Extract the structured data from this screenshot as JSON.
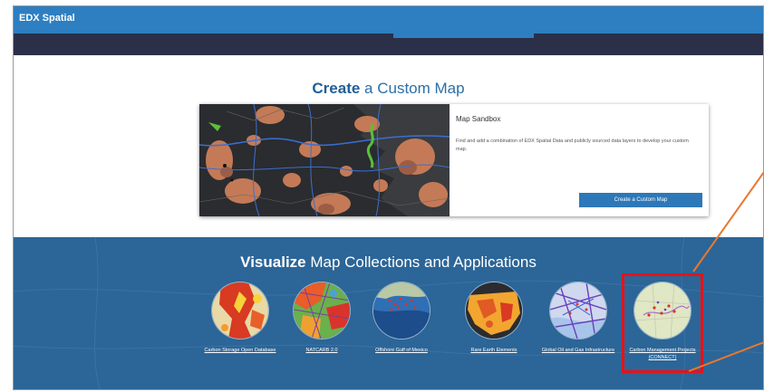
{
  "app": {
    "title": "EDX Spatial"
  },
  "create": {
    "title_bold": "Create",
    "title_rest": " a Custom Map",
    "card": {
      "title": "Map Sandbox",
      "description": "Find and add a combination of EDX Spatial Data and publicly sourced data layers to develop your custom map.",
      "button_label": "Create a Custom Map"
    }
  },
  "visualize": {
    "title_bold": "Visualize",
    "title_rest": " Map Collections and Applications",
    "items": [
      {
        "label": "Carbon Storage Open Database",
        "icon": "carbon-storage-map-thumbnail"
      },
      {
        "label": "NATCARB 2.0",
        "icon": "natcarb-map-thumbnail"
      },
      {
        "label": "Offshore Gulf of Mexico",
        "icon": "offshore-gulf-map-thumbnail"
      },
      {
        "label": "Rare Earth Elements",
        "icon": "rare-earth-map-thumbnail"
      },
      {
        "label": "Global Oil and Gas Infrastructure",
        "icon": "global-oil-gas-map-thumbnail"
      },
      {
        "label": "Carbon Management Projects (CONNECT)",
        "icon": "carbon-management-map-thumbnail"
      }
    ]
  },
  "colors": {
    "header_blue": "#2d7fc1",
    "nav_dark": "#2b2f48",
    "section_blue": "#2c6597",
    "highlight_red": "#e3131b",
    "callout_orange": "#e8782f"
  }
}
